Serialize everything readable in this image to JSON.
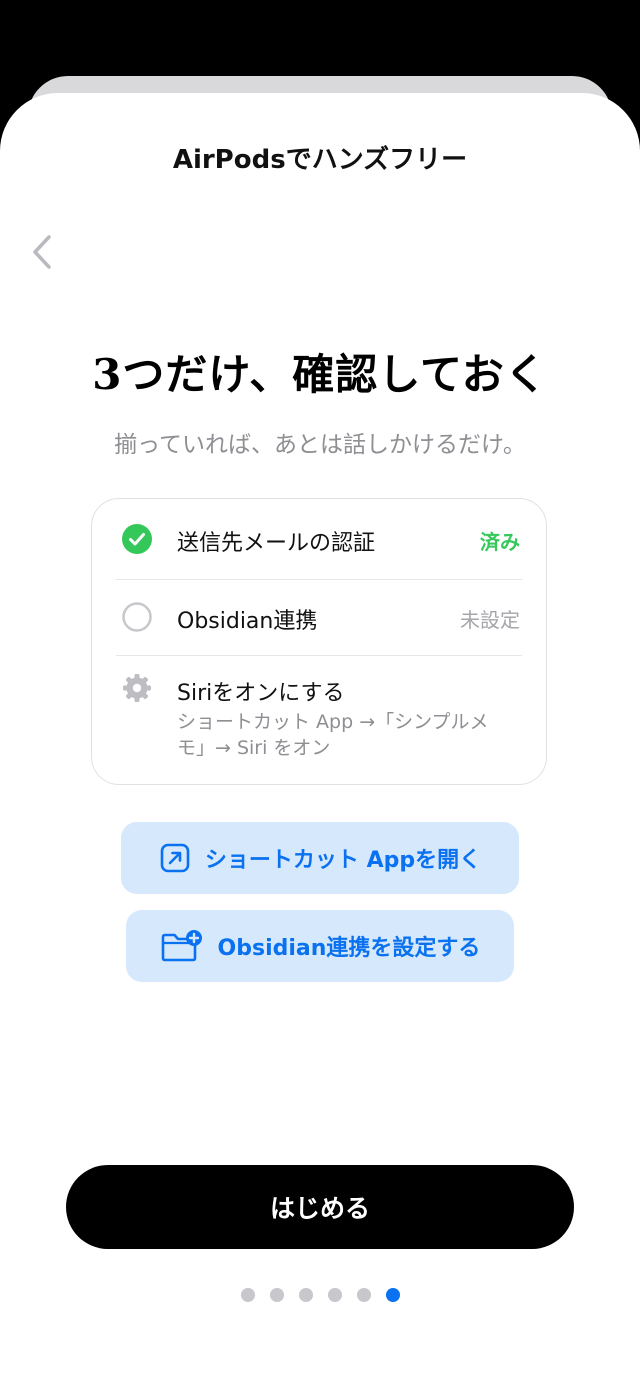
{
  "header": {
    "title": "AirPodsでハンズフリー",
    "back_icon": "chevron-left-icon"
  },
  "main": {
    "headline": "3つだけ、確認しておく",
    "subtitle": "揃っていれば、あとは話しかけるだけ。"
  },
  "checklist": {
    "items": [
      {
        "label": "送信先メールの認証",
        "status": "済み",
        "icon": "checkmark-circle-icon",
        "state": "done"
      },
      {
        "label": "Obsidian連携",
        "status": "未設定",
        "icon": "empty-circle-icon",
        "state": "pending"
      },
      {
        "label": "Siriをオンにする",
        "detail": "ショートカット App →「シンプルメモ」→ Siri をオン",
        "icon": "gear-icon",
        "state": "manual"
      }
    ]
  },
  "actions": {
    "open_shortcuts": {
      "label": "ショートカット Appを開く",
      "icon": "external-link-icon"
    },
    "setup_obsidian": {
      "label": "Obsidian連携を設定する",
      "icon": "folder-plus-icon"
    }
  },
  "footer": {
    "start_label": "はじめる",
    "page_count": 6,
    "current_page": 6
  },
  "colors": {
    "accent": "#0A72F0",
    "success": "#34C759",
    "button_tint": "#D6E8FB",
    "secondary_text": "#8E8E93"
  }
}
